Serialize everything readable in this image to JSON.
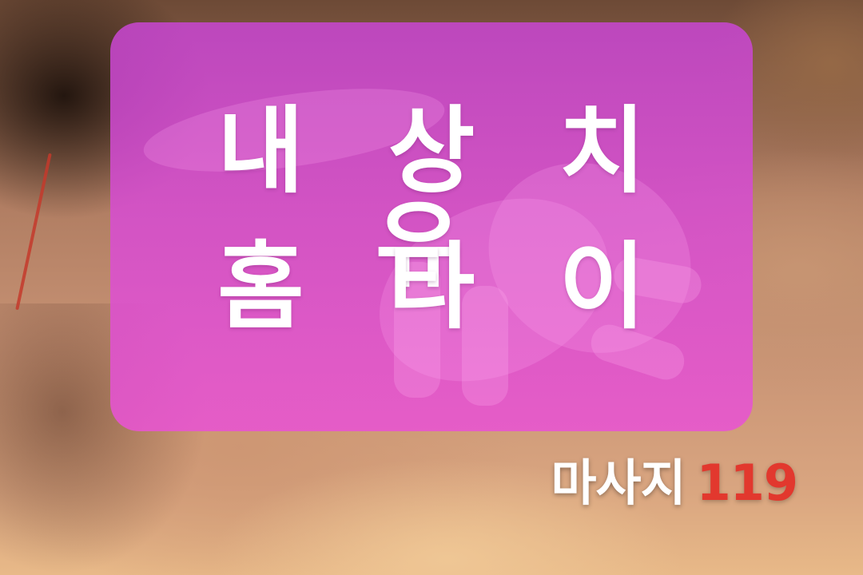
{
  "card": {
    "line1": "내 상 치 유",
    "line2": "홈 타 이"
  },
  "brand": {
    "text": "마사지",
    "number": "119"
  },
  "colors": {
    "card": "#d050d6",
    "title_text": "#ffffff",
    "brand_number": "#e2382e"
  }
}
